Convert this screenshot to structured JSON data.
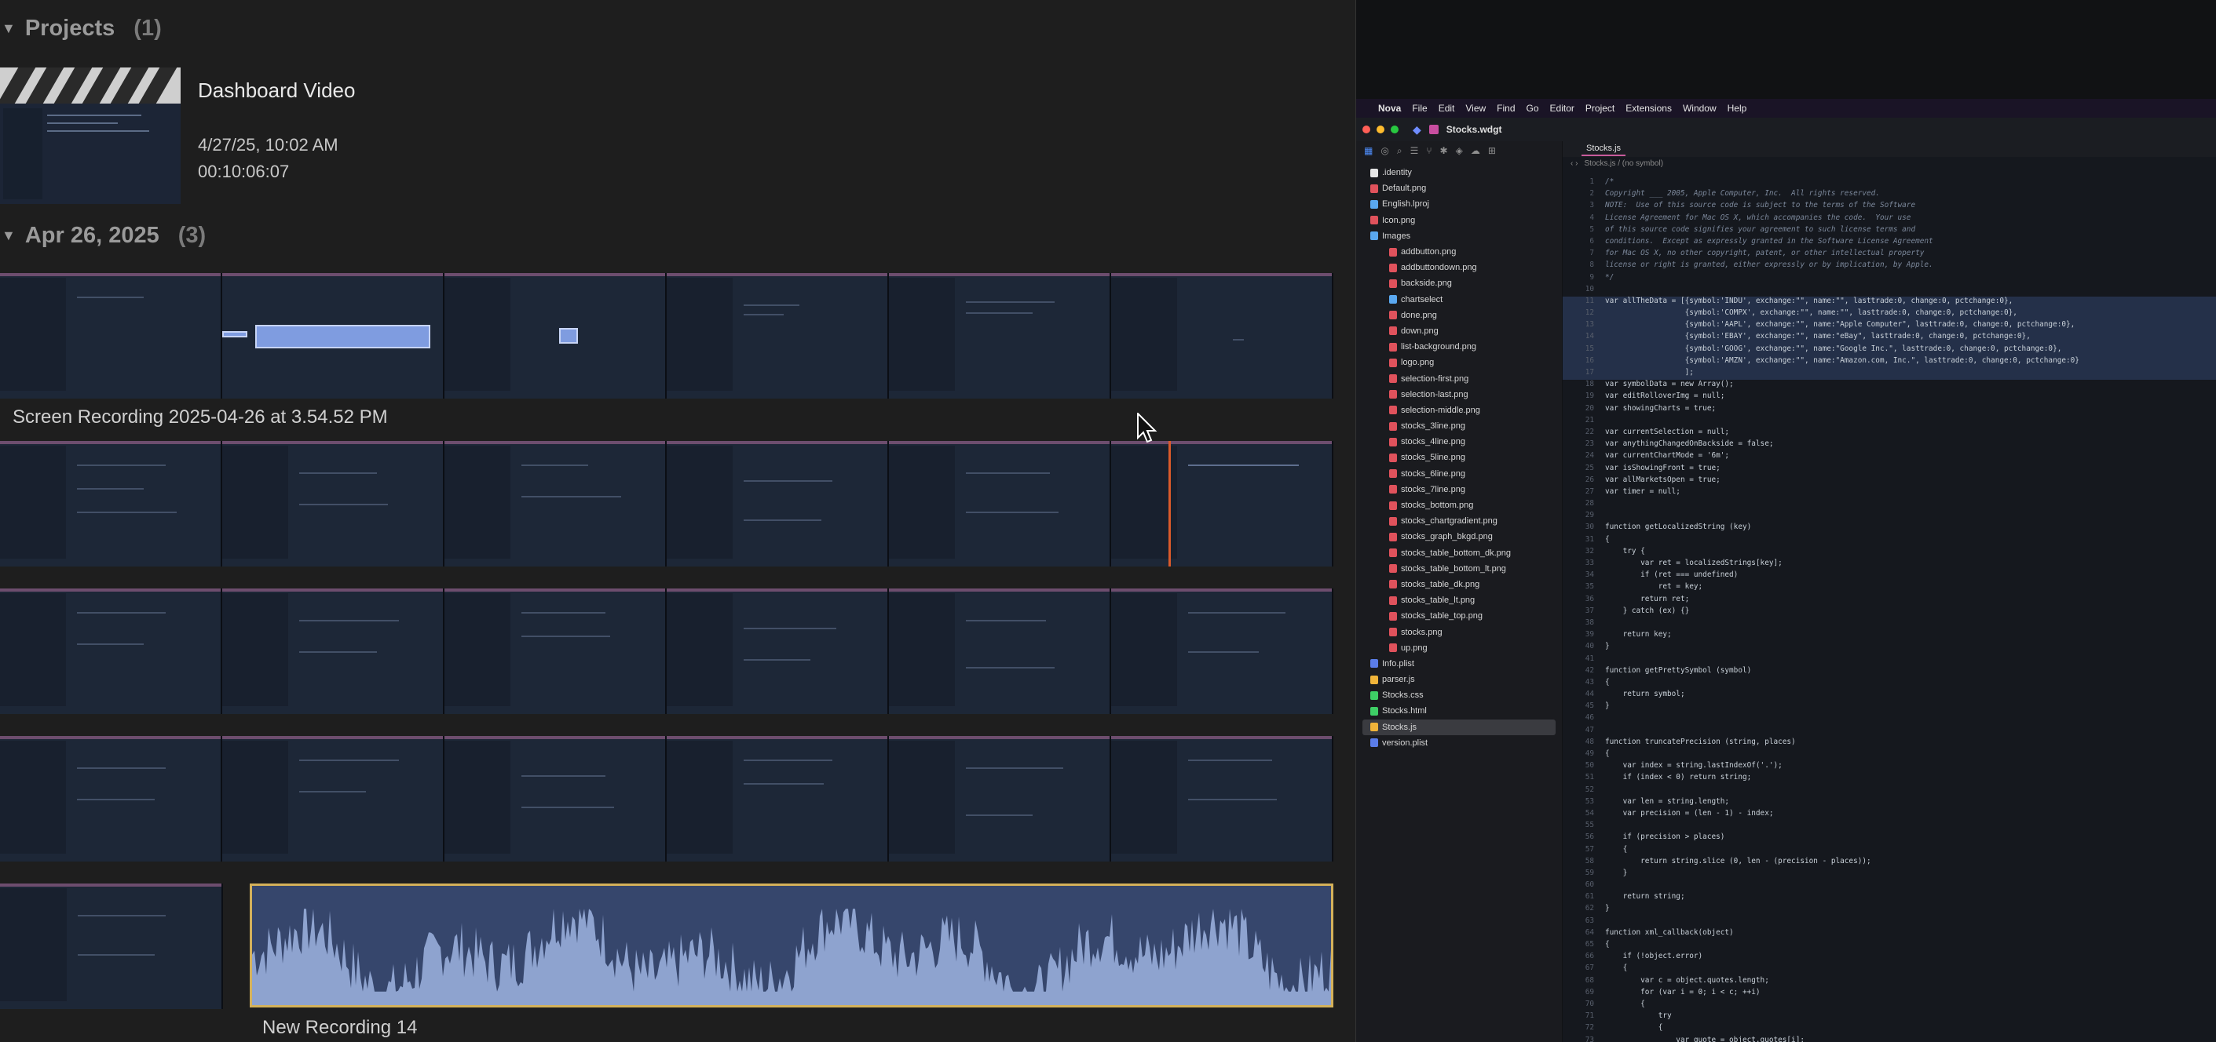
{
  "projects": {
    "title": "Projects",
    "count": "(1)"
  },
  "project": {
    "title": "Dashboard Video",
    "date": "4/27/25, 10:02 AM",
    "duration": "00:10:06:07"
  },
  "day": {
    "title": "Apr 26, 2025",
    "count": "(3)"
  },
  "clips": {
    "screen_recording_label": "Screen Recording 2025-04-26 at 3.54.52 PM",
    "audio_label": "New Recording 14"
  },
  "nova": {
    "menu": [
      "Nova",
      "File",
      "Edit",
      "View",
      "Find",
      "Go",
      "Editor",
      "Project",
      "Extensions",
      "Window",
      "Help"
    ],
    "window_title": "Stocks.wdgt",
    "tab": "Stocks.js",
    "breadcrumb": "Stocks.js  /  (no symbol)",
    "files": [
      {
        "name": ".identity",
        "type": "file",
        "indent": 0
      },
      {
        "name": "Default.png",
        "type": "img",
        "indent": 0
      },
      {
        "name": "English.lproj",
        "type": "folder",
        "indent": 0
      },
      {
        "name": "Icon.png",
        "type": "img",
        "indent": 0
      },
      {
        "name": "Images",
        "type": "folder",
        "indent": 0
      },
      {
        "name": "addbutton.png",
        "type": "img",
        "indent": 1
      },
      {
        "name": "addbuttondown.png",
        "type": "img",
        "indent": 1
      },
      {
        "name": "backside.png",
        "type": "img",
        "indent": 1
      },
      {
        "name": "chartselect",
        "type": "folder",
        "indent": 1
      },
      {
        "name": "done.png",
        "type": "img",
        "indent": 1
      },
      {
        "name": "down.png",
        "type": "img",
        "indent": 1
      },
      {
        "name": "list-background.png",
        "type": "img",
        "indent": 1
      },
      {
        "name": "logo.png",
        "type": "img",
        "indent": 1
      },
      {
        "name": "selection-first.png",
        "type": "img",
        "indent": 1
      },
      {
        "name": "selection-last.png",
        "type": "img",
        "indent": 1
      },
      {
        "name": "selection-middle.png",
        "type": "img",
        "indent": 1
      },
      {
        "name": "stocks_3line.png",
        "type": "img",
        "indent": 1
      },
      {
        "name": "stocks_4line.png",
        "type": "img",
        "indent": 1
      },
      {
        "name": "stocks_5line.png",
        "type": "img",
        "indent": 1
      },
      {
        "name": "stocks_6line.png",
        "type": "img",
        "indent": 1
      },
      {
        "name": "stocks_7line.png",
        "type": "img",
        "indent": 1
      },
      {
        "name": "stocks_bottom.png",
        "type": "img",
        "indent": 1
      },
      {
        "name": "stocks_chartgradient.png",
        "type": "img",
        "indent": 1
      },
      {
        "name": "stocks_graph_bkgd.png",
        "type": "img",
        "indent": 1
      },
      {
        "name": "stocks_table_bottom_dk.png",
        "type": "img",
        "indent": 1
      },
      {
        "name": "stocks_table_bottom_lt.png",
        "type": "img",
        "indent": 1
      },
      {
        "name": "stocks_table_dk.png",
        "type": "img",
        "indent": 1
      },
      {
        "name": "stocks_table_lt.png",
        "type": "img",
        "indent": 1
      },
      {
        "name": "stocks_table_top.png",
        "type": "img",
        "indent": 1
      },
      {
        "name": "stocks.png",
        "type": "img",
        "indent": 1
      },
      {
        "name": "up.png",
        "type": "img",
        "indent": 1
      },
      {
        "name": "Info.plist",
        "type": "plist",
        "indent": 0
      },
      {
        "name": "parser.js",
        "type": "js",
        "indent": 0
      },
      {
        "name": "Stocks.css",
        "type": "css",
        "indent": 0
      },
      {
        "name": "Stocks.html",
        "type": "html",
        "indent": 0
      },
      {
        "name": "Stocks.js",
        "type": "js",
        "indent": 0,
        "selected": true
      },
      {
        "name": "version.plist",
        "type": "plist",
        "indent": 0
      }
    ],
    "code": [
      "/*",
      "Copyright ___ 2005, Apple Computer, Inc.  All rights reserved.",
      "NOTE:  Use of this source code is subject to the terms of the Software",
      "License Agreement for Mac OS X, which accompanies the code.  Your use",
      "of this source code signifies your agreement to such license terms and",
      "conditions.  Except as expressly granted in the Software License Agreement",
      "for Mac OS X, no other copyright, patent, or other intellectual property",
      "license or right is granted, either expressly or by implication, by Apple.",
      "*/",
      "",
      "var allTheData = [{symbol:'INDU', exchange:\"\", name:\"\", lasttrade:0, change:0, pctchange:0},",
      "                  {symbol:'COMPX', exchange:\"\", name:\"\", lasttrade:0, change:0, pctchange:0},",
      "                  {symbol:'AAPL', exchange:\"\", name:\"Apple Computer\", lasttrade:0, change:0, pctchange:0},",
      "                  {symbol:'EBAY', exchange:\"\", name:\"eBay\", lasttrade:0, change:0, pctchange:0},",
      "                  {symbol:'GOOG', exchange:\"\", name:\"Google Inc.\", lasttrade:0, change:0, pctchange:0},",
      "                  {symbol:'AMZN', exchange:\"\", name:\"Amazon.com, Inc.\", lasttrade:0, change:0, pctchange:0}",
      "                  ];",
      "var symbolData = new Array();",
      "var editRolloverImg = null;",
      "var showingCharts = true;",
      "",
      "var currentSelection = null;",
      "var anythingChangedOnBackside = false;",
      "var currentChartMode = '6m';",
      "var isShowingFront = true;",
      "var allMarketsOpen = true;",
      "var timer = null;",
      "",
      "",
      "function getLocalizedString (key)",
      "{",
      "    try {",
      "        var ret = localizedStrings[key];",
      "        if (ret === undefined)",
      "            ret = key;",
      "        return ret;",
      "    } catch (ex) {}",
      "",
      "    return key;",
      "}",
      "",
      "function getPrettySymbol (symbol)",
      "{",
      "    return symbol;",
      "}",
      "",
      "",
      "function truncatePrecision (string, places)",
      "{",
      "    var index = string.lastIndexOf('.');",
      "    if (index < 0) return string;",
      "",
      "    var len = string.length;",
      "    var precision = (len - 1) - index;",
      "",
      "    if (precision > places)",
      "    {",
      "        return string.slice (0, len - (precision - places));",
      "    }",
      "",
      "    return string;",
      "}",
      "",
      "function xml_callback(object)",
      "{",
      "    if (!object.error)",
      "    {",
      "        var c = object.quotes.length;",
      "        for (var i = 0; i < c; ++i)",
      "        {",
      "            try",
      "            {",
      "                var quote = object.quotes[i];"
    ],
    "highlight_lines": [
      11,
      12,
      13,
      14,
      15,
      16,
      17
    ]
  }
}
